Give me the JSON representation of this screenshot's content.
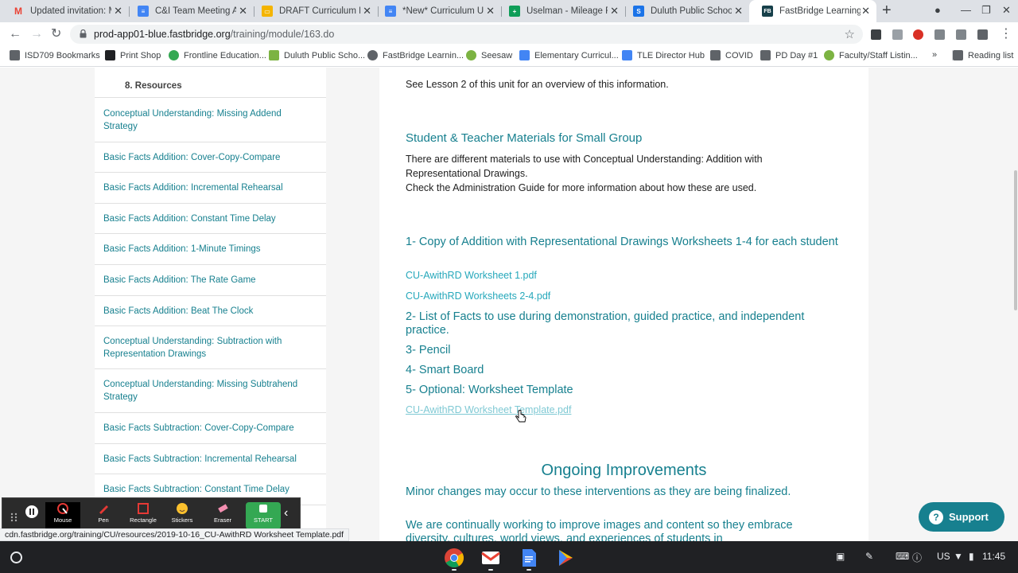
{
  "tabs": [
    {
      "title": "Updated invitation: Mo",
      "icon": "gmail-icon",
      "color": "#ea4335"
    },
    {
      "title": "C&I Team Meeting Age",
      "icon": "docs-icon",
      "color": "#4285f4"
    },
    {
      "title": "DRAFT Curriculum Rev",
      "icon": "slides-icon",
      "color": "#f4b400"
    },
    {
      "title": "*New* Curriculum Unit",
      "icon": "docs-icon",
      "color": "#4285f4"
    },
    {
      "title": "Uselman - Mileage Rei",
      "icon": "sheets-icon",
      "color": "#0f9d58"
    },
    {
      "title": "Duluth Public Schools",
      "icon": "school-icon",
      "color": "#1a73e8"
    },
    {
      "title": "FastBridge Learning -",
      "icon": "fastbridge-icon",
      "color": "#17404a",
      "active": true
    }
  ],
  "address": {
    "host": "prod-app01-blue.fastbridge.org",
    "path": "/training/module/163.do"
  },
  "bookmarks": [
    "ISD709 Bookmarks",
    "Print Shop",
    "Frontline Education...",
    "Duluth Public Scho...",
    "FastBridge Learnin...",
    "Seesaw",
    "Elementary Curricul...",
    "TLE Director Hub",
    "COVID",
    "PD Day #1",
    "Faculty/Staff Listin...",
    "»",
    "Reading list"
  ],
  "sidebar": {
    "heading": "8. Resources",
    "items": [
      "Conceptual Understanding: Missing Addend Strategy",
      "Basic Facts Addition: Cover-Copy-Compare",
      "Basic Facts Addition: Incremental Rehearsal",
      "Basic Facts Addition: Constant Time Delay",
      "Basic Facts Addition: 1-Minute Timings",
      "Basic Facts Addition: The Rate Game",
      "Basic Facts Addition: Beat The Clock",
      "Conceptual Understanding: Subtraction with Representation Drawings",
      "Conceptual Understanding: Missing Subtrahend Strategy",
      "Basic Facts Subtraction: Cover-Copy-Compare",
      "Basic Facts Subtraction: Incremental Rehearsal",
      "Basic Facts Subtraction: Constant Time Delay"
    ]
  },
  "content": {
    "intro": "See Lesson 2 of this unit for an overview of this information.",
    "materials_heading": "Student & Teacher Materials for Small Group",
    "materials_p1": "There are different materials to use with Conceptual Understanding: Addition with Representational Drawings.",
    "materials_p2": "Check the Administration Guide for more information about how these are used.",
    "item1": "1- Copy of Addition with Representational Drawings Worksheets 1-4 for each student",
    "link1": "CU-AwithRD Worksheet 1.pdf",
    "link2": "CU-AwithRD Worksheets 2-4.pdf",
    "item2": "2- List of Facts to use during demonstration, guided practice, and independent practice.",
    "item3": "3- Pencil",
    "item4": "4- Smart Board",
    "item5": "5- Optional: Worksheet Template",
    "link3": "CU-AwithRD Worksheet Template.pdf",
    "improve_heading": "Ongoing Improvements",
    "improve_p1": "Minor changes may occur to these interventions as they are being finalized.",
    "improve_p2": "We are continually working to improve images and content so they embrace diversity, cultures, world views, and experiences of students in"
  },
  "support_label": "Support",
  "annotation_tools": [
    "Mouse",
    "Pen",
    "Rectangle",
    "Stickers",
    "Eraser",
    "START"
  ],
  "status_url": "cdn.fastbridge.org/training/CU/resources/2019-10-16_CU-AwithRD Worksheet Template.pdf",
  "tray": {
    "locale": "US",
    "time": "11:45"
  },
  "colors": {
    "teal": "#17808f",
    "link": "#26a8bb"
  }
}
